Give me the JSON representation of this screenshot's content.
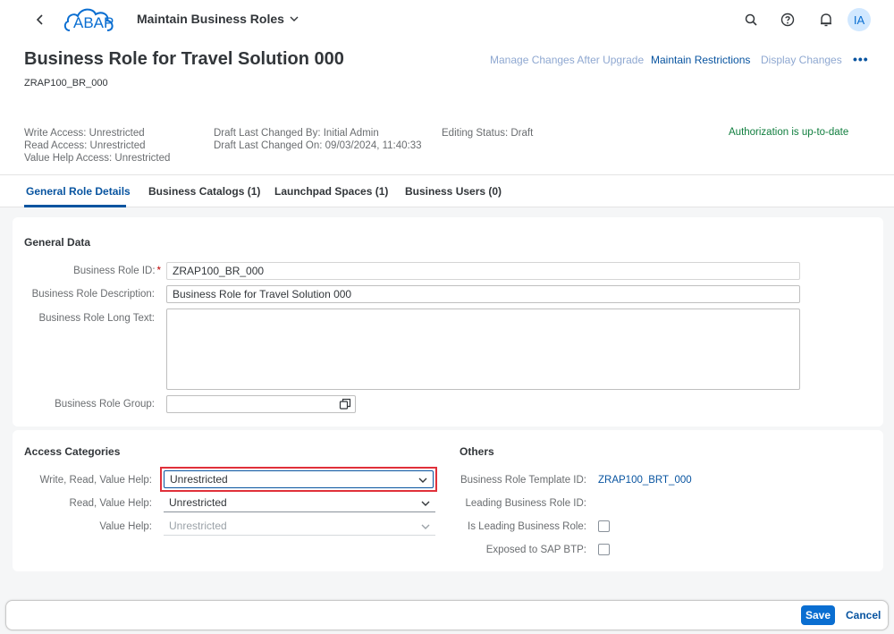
{
  "shell": {
    "logo_text": "ABAP",
    "app_title": "Maintain Business Roles",
    "avatar_initials": "IA",
    "icons": [
      "back-icon",
      "search-icon",
      "help-icon",
      "bell-icon"
    ]
  },
  "header": {
    "title": "Business Role for Travel Solution 000",
    "subtitle": "ZRAP100_BR_000",
    "actions": {
      "manage_changes": "Manage Changes After Upgrade",
      "maintain_restrictions": "Maintain Restrictions",
      "display_changes": "Display Changes",
      "more": "•••"
    },
    "attributes": {
      "write_access": "Write Access: Unrestricted",
      "read_access": "Read Access: Unrestricted",
      "value_help_access": "Value Help Access: Unrestricted",
      "draft_changed_by": "Draft Last Changed By: Initial Admin",
      "draft_changed_on": "Draft Last Changed On: 09/03/2024, 11:40:33",
      "editing_status": "Editing Status: Draft"
    },
    "authorization_status": "Authorization is up-to-date"
  },
  "tabs": [
    {
      "label": "General Role Details",
      "active": true
    },
    {
      "label": "Business Catalogs (1)",
      "active": false
    },
    {
      "label": "Launchpad Spaces (1)",
      "active": false
    },
    {
      "label": "Business Users (0)",
      "active": false
    }
  ],
  "general_data": {
    "title": "General Data",
    "role_id_label": "Business Role ID:",
    "role_id_required": "*",
    "role_id_value": "ZRAP100_BR_000",
    "description_label": "Business Role Description:",
    "description_value": "Business Role for Travel Solution 000",
    "long_text_label": "Business Role Long Text:",
    "long_text_value": "",
    "group_label": "Business Role Group:",
    "group_value": ""
  },
  "access_categories": {
    "title": "Access Categories",
    "write_read_vh_label": "Write, Read, Value Help:",
    "write_read_vh_value": "Unrestricted",
    "read_vh_label": "Read, Value Help:",
    "read_vh_value": "Unrestricted",
    "vh_label": "Value Help:",
    "vh_value": "Unrestricted"
  },
  "others": {
    "title": "Others",
    "template_id_label": "Business Role Template ID:",
    "template_id_value": "ZRAP100_BRT_000",
    "leading_role_id_label": "Leading Business Role ID:",
    "is_leading_label": "Is Leading Business Role:",
    "exposed_btp_label": "Exposed to SAP BTP:"
  },
  "footer": {
    "save_label": "Save",
    "cancel_label": "Cancel"
  },
  "colors": {
    "brand": "#0a6ed1",
    "link": "#0854a0",
    "success": "#107e3e",
    "highlight": "#e0303a"
  }
}
